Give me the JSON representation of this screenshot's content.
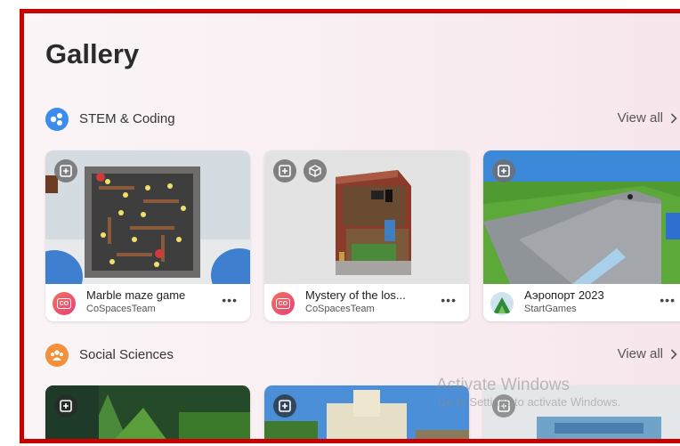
{
  "page": {
    "title": "Gallery"
  },
  "sections": [
    {
      "label": "STEM & Coding",
      "icon": "molecule-icon",
      "view_all": "View all",
      "cards": [
        {
          "name": "Marble maze game",
          "author": "CoSpacesTeam",
          "avatar": "cospaces-logo-icon",
          "menu": "•••",
          "badges": [
            "add-to-library-icon"
          ]
        },
        {
          "name": "Mystery of the los...",
          "author": "CoSpacesTeam",
          "avatar": "cospaces-logo-icon",
          "menu": "•••",
          "badges": [
            "add-to-library-icon",
            "cube-icon"
          ]
        },
        {
          "name": "Аэропорт 2023",
          "author": "StartGames",
          "avatar": "user-avatar",
          "menu": "•••",
          "badges": [
            "add-to-library-icon"
          ]
        }
      ]
    },
    {
      "label": "Social Sciences",
      "icon": "people-group-icon",
      "view_all": "View all"
    }
  ],
  "cospaces_mark": "CO",
  "overlay": {
    "title": "Activate Windows",
    "subtitle": "Go to Settings to activate Windows."
  },
  "colors": {
    "frame_border": "#c80000",
    "stem_icon": "#3c8cf0",
    "social_icon": "#f3913a",
    "cospaces_gradient": [
      "#f2705b",
      "#e6427a"
    ]
  }
}
